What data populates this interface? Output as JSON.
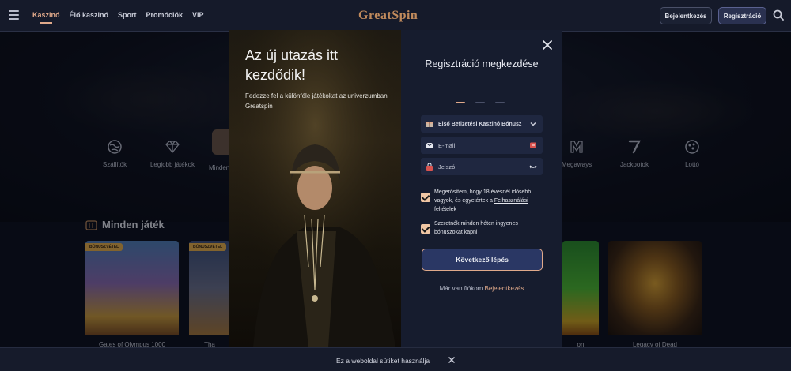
{
  "nav": {
    "items": [
      {
        "label": "Kaszinó",
        "active": true
      },
      {
        "label": "Élő kaszinó",
        "active": false
      },
      {
        "label": "Sport",
        "active": false
      },
      {
        "label": "Promóciók",
        "active": false
      },
      {
        "label": "VIP",
        "active": false
      }
    ],
    "logo": "GreatSpin",
    "login": "Bejelentkezés",
    "register": "Regisztráció"
  },
  "categories": [
    {
      "label": "Szállítók",
      "icon": "globe-icon"
    },
    {
      "label": "Legjobb játékok",
      "icon": "diamond-icon"
    },
    {
      "label": "Minden",
      "icon": "all-games-icon"
    },
    {
      "label": "Megaways",
      "icon": "megaways-icon"
    },
    {
      "label": "Jackpotok",
      "icon": "seven-icon"
    },
    {
      "label": "Lottó",
      "icon": "lotto-ball-icon"
    }
  ],
  "section": {
    "title": "Minden játék"
  },
  "games": [
    {
      "name": "Gates of Olympus 1000",
      "badge": "BÓNUSZVÉTEL"
    },
    {
      "name": "Tha",
      "badge": "BÓNUSZVÉTEL"
    },
    {
      "name": "on",
      "badge": ""
    },
    {
      "name": "Legacy of Dead",
      "badge": ""
    }
  ],
  "modal": {
    "headline": "Az új utazás itt kezdődik!",
    "subtext": "Fedezze fel a különféle játékokat az univerzumban Greatspin",
    "title": "Regisztráció megkezdése",
    "bonus_select": "Első Befizetési Kaszinó Bónusz",
    "email_placeholder": "E-mail",
    "password_placeholder": "Jelszó",
    "check1_text": "Megerősítem, hogy 18 évesnél idősebb vagyok, és egyetértek a",
    "check1_link": "Felhasználási feltételek",
    "check2_text": "Szeretnék minden héten ingyenes bónuszokat kapni",
    "next_button": "Következő lépés",
    "already_text": "Már van fiókom",
    "already_link": "Bejelentkezés",
    "steps": {
      "current": 1,
      "total": 3
    }
  },
  "cookie": {
    "text": "Ez a weboldal sütiket használja"
  },
  "colors": {
    "accent": "#e0a98a",
    "bg": "#0b0f1c",
    "panel": "#161c2e",
    "field": "#1f2740",
    "button": "#2a3764"
  }
}
